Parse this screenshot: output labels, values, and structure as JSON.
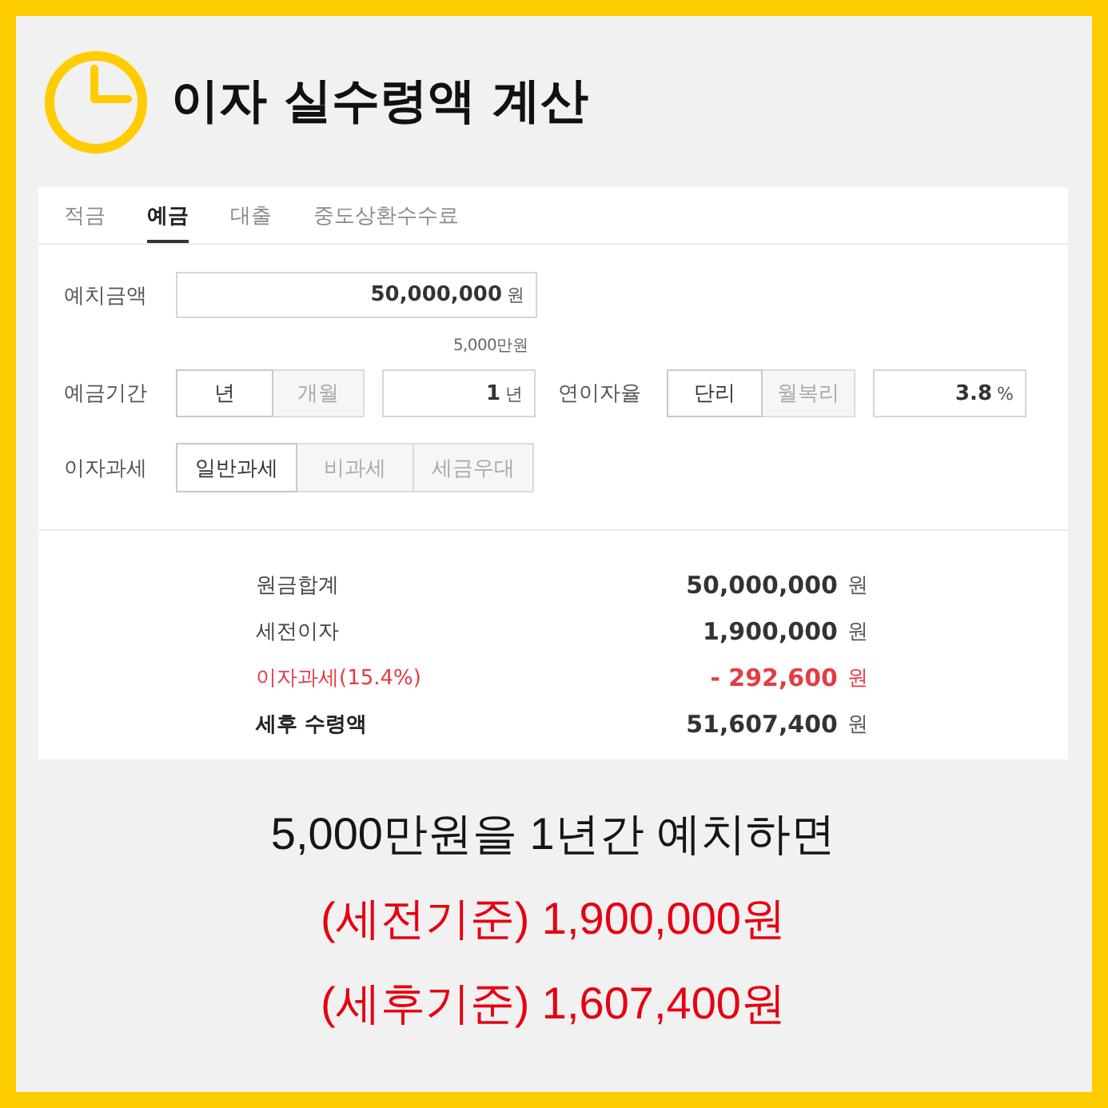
{
  "header": {
    "title": "이자 실수령액 계산"
  },
  "tabs": [
    {
      "label": "적금",
      "selected": false
    },
    {
      "label": "예금",
      "selected": true
    },
    {
      "label": "대출",
      "selected": false
    },
    {
      "label": "중도상환수수료",
      "selected": false
    }
  ],
  "deposit": {
    "label": "예치금액",
    "value": "50,000,000",
    "unit": "원",
    "hint": "5,000만원"
  },
  "period": {
    "label": "예금기간",
    "options": [
      {
        "label": "년",
        "selected": true
      },
      {
        "label": "개월",
        "selected": false
      }
    ],
    "value": "1",
    "unit": "년"
  },
  "rate": {
    "label": "연이자율",
    "options": [
      {
        "label": "단리",
        "selected": true
      },
      {
        "label": "월복리",
        "selected": false
      }
    ],
    "value": "3.8",
    "unit": "%"
  },
  "taxation": {
    "label": "이자과세",
    "options": [
      {
        "label": "일반과세",
        "selected": true
      },
      {
        "label": "비과세",
        "selected": false
      },
      {
        "label": "세금우대",
        "selected": false
      }
    ]
  },
  "results": [
    {
      "kind": "amount",
      "label": "원금합계",
      "value": "50,000,000",
      "unit": "원"
    },
    {
      "kind": "amount",
      "label": "세전이자",
      "value": "1,900,000",
      "unit": "원"
    },
    {
      "kind": "deduction",
      "label": "이자과세(15.4%)",
      "value": "- 292,600",
      "unit": "원"
    },
    {
      "kind": "total",
      "label": "세후 수령액",
      "value": "51,607,400",
      "unit": "원"
    }
  ],
  "summary": [
    {
      "kind": "plain",
      "text": "5,000만원을 1년간 예치하면"
    },
    {
      "kind": "emphasis",
      "text": "(세전기준) 1,900,000원"
    },
    {
      "kind": "emphasis",
      "text": "(세후기준) 1,607,400원"
    }
  ]
}
